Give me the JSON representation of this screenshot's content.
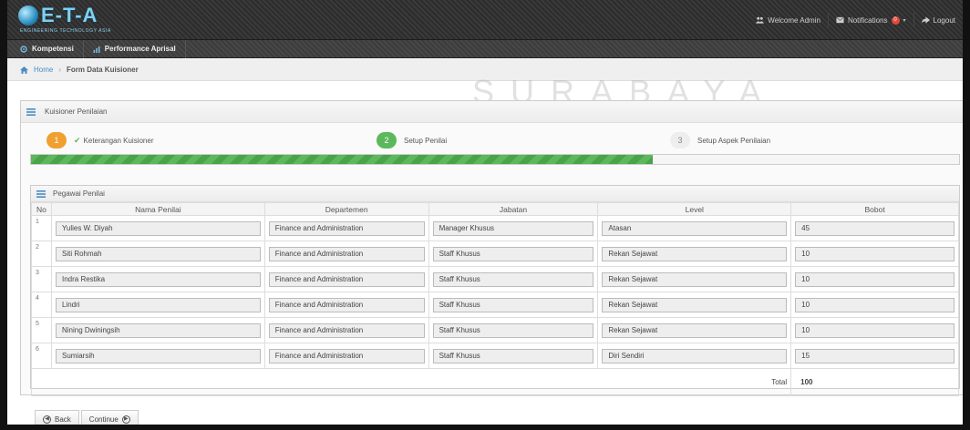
{
  "header": {
    "logo_text": "E-T-A",
    "logo_subtitle": "ENGINEERING TECHNOLOGY ASIA",
    "welcome": "Welcome Admin",
    "notifications_label": "Notifications",
    "notifications_count": "0",
    "logout": "Logout"
  },
  "nav": {
    "items": [
      {
        "label": "Kompetensi"
      },
      {
        "label": "Performance Aprisal"
      }
    ]
  },
  "breadcrumb": {
    "home": "Home",
    "current": "Form Data Kuisioner"
  },
  "panel": {
    "title": "Kuisioner Penilaian"
  },
  "steps": [
    {
      "number": "1",
      "label": "Keterangan Kuisioner",
      "state": "done",
      "color": "#f0a030"
    },
    {
      "number": "2",
      "label": "Setup Penilai",
      "state": "active",
      "color": "#5cb85c"
    },
    {
      "number": "3",
      "label": "Setup Aspek Penilaian",
      "state": "pending",
      "color": "#dddddd"
    }
  ],
  "progress": {
    "percent": 67
  },
  "sub_panel": {
    "title": "Pegawai Penilai"
  },
  "table": {
    "headers": [
      "No",
      "Nama Penilai",
      "Departemen",
      "Jabatan",
      "Level",
      "Bobot"
    ],
    "rows": [
      {
        "no": "1",
        "nama": "Yulies W. Diyah",
        "departemen": "Finance and Administration",
        "jabatan": "Manager Khusus",
        "level": "Atasan",
        "bobot": "45"
      },
      {
        "no": "2",
        "nama": "Siti Rohmah",
        "departemen": "Finance and Administration",
        "jabatan": "Staff Khusus",
        "level": "Rekan Sejawat",
        "bobot": "10"
      },
      {
        "no": "3",
        "nama": "Indra Restika",
        "departemen": "Finance and Administration",
        "jabatan": "Staff Khusus",
        "level": "Rekan Sejawat",
        "bobot": "10"
      },
      {
        "no": "4",
        "nama": "Lindri",
        "departemen": "Finance and Administration",
        "jabatan": "Staff Khusus",
        "level": "Rekan Sejawat",
        "bobot": "10"
      },
      {
        "no": "5",
        "nama": "Nining Dwiningsih",
        "departemen": "Finance and Administration",
        "jabatan": "Staff Khusus",
        "level": "Rekan Sejawat",
        "bobot": "10"
      },
      {
        "no": "6",
        "nama": "Sumiarsih",
        "departemen": "Finance and Administration",
        "jabatan": "Staff Khusus",
        "level": "Diri Sendiri",
        "bobot": "15"
      }
    ],
    "total_label": "Total",
    "total_value": "100"
  },
  "actions": {
    "back": "Back",
    "continue": "Continue"
  },
  "watermark": {
    "text": "SURABAYA"
  },
  "colors": {
    "accent_blue": "#4a8bc2",
    "success_green": "#5cb85c",
    "step_orange": "#f0a030"
  }
}
